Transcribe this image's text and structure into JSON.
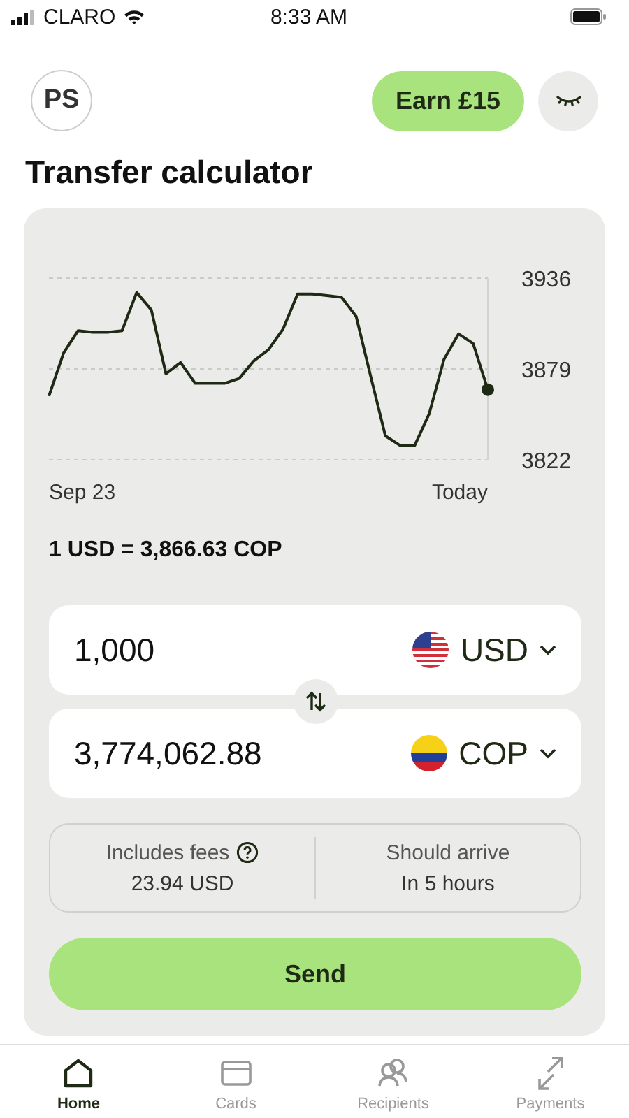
{
  "status_bar": {
    "carrier": "CLARO",
    "time": "8:33 AM"
  },
  "header": {
    "avatar": "PS",
    "earn_button": "Earn £15"
  },
  "title": "Transfer calculator",
  "calculator": {
    "chart_data": {
      "type": "line",
      "series": [
        {
          "color": "#1e2a14",
          "values": [
            3862,
            3889,
            3903,
            3902,
            3902,
            3903,
            3927,
            3916,
            3876,
            3883,
            3870,
            3870,
            3870,
            3873,
            3884,
            3891,
            3904,
            3926,
            3926,
            3925,
            3924,
            3912,
            3874,
            3837,
            3831,
            3831,
            3851,
            3885,
            3901,
            3895,
            3866
          ]
        }
      ],
      "ylim": [
        3822,
        3936
      ],
      "yticks": [
        3822,
        3879,
        3936
      ]
    },
    "chart_range": {
      "start": "Sep 23",
      "end": "Today"
    },
    "rate": "1 USD = 3,866.63 COP",
    "amounts": [
      {
        "value": "1,000",
        "currency": "USD"
      },
      {
        "value": "3,774,062.88",
        "currency": "COP"
      }
    ],
    "fees": {
      "label": "Includes fees",
      "value": "23.94 USD"
    },
    "arrival": {
      "label": "Should arrive",
      "value": "In 5 hours"
    },
    "send_button": "Send"
  },
  "tabs": [
    {
      "label": "Home",
      "selected": true
    },
    {
      "label": "Cards",
      "selected": false
    },
    {
      "label": "Recipients",
      "selected": false
    },
    {
      "label": "Payments",
      "selected": false
    }
  ]
}
